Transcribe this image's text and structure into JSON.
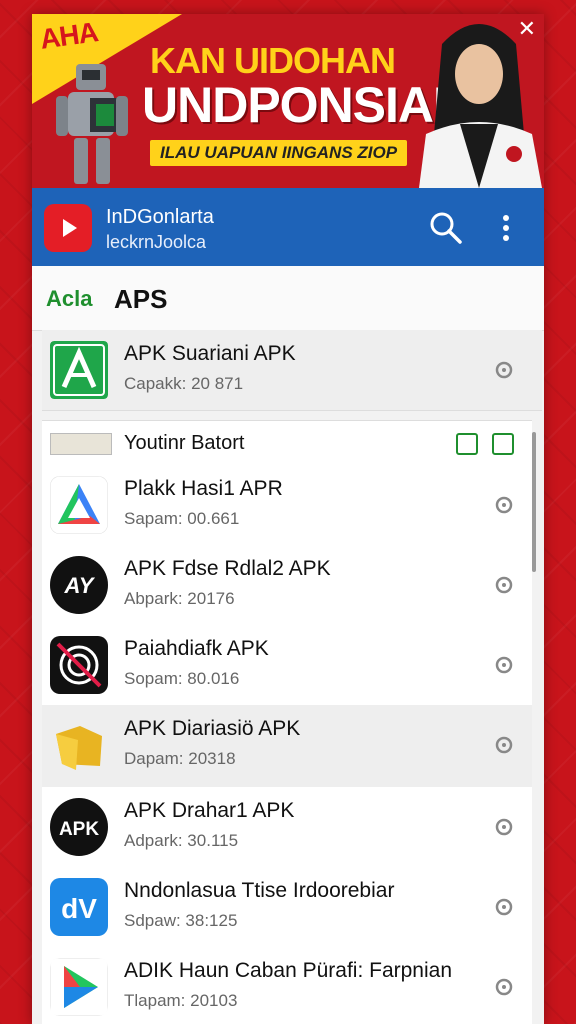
{
  "banner": {
    "logo": "AHA",
    "title_line1": "KAN UIDOHAN",
    "title_line2": "UNDPONSIAI",
    "tagline": "ILAU UAPUAN IINGANS ZIOP",
    "close_glyph": "✕"
  },
  "header": {
    "title": "InDGonlarta",
    "subtitle": "leckrnJoolca",
    "accent_color": "#1e63b8",
    "icons": [
      "youtube-icon",
      "search-icon",
      "more-vert-icon"
    ]
  },
  "section": {
    "tag": "Acla",
    "title": "APS"
  },
  "featured_app": {
    "name": "APK Suariani APK",
    "meta": "Capakk: 20 871"
  },
  "subbar": {
    "label": "Youtinr Batort"
  },
  "apps": [
    {
      "name": "Plakk Hasi1 APR",
      "meta": "Sapam: 00.661",
      "icon": "delta-icon"
    },
    {
      "name": "APK Fdse Rdlal2 APK",
      "meta": "Abpark: 20176",
      "icon": "ay-icon"
    },
    {
      "name": "Paiahdiafk APK",
      "meta": "Sopam: 80.016",
      "icon": "target-icon"
    },
    {
      "name": "APK Diariasiö APK",
      "meta": "Dapam: 20318",
      "icon": "folder-icon"
    },
    {
      "name": "APK Drahar1 APK",
      "meta": "Adpark: 30.115",
      "icon": "apk-icon"
    },
    {
      "name": "Nndonlasua Ttise Irdoorebiar",
      "meta": "Sdpaw: 38:125",
      "icon": "dv-icon"
    },
    {
      "name": "ADIK Haun Caban Pürafi: Farpnian",
      "meta": "Tlapam: 20103",
      "icon": "play-icon"
    }
  ]
}
